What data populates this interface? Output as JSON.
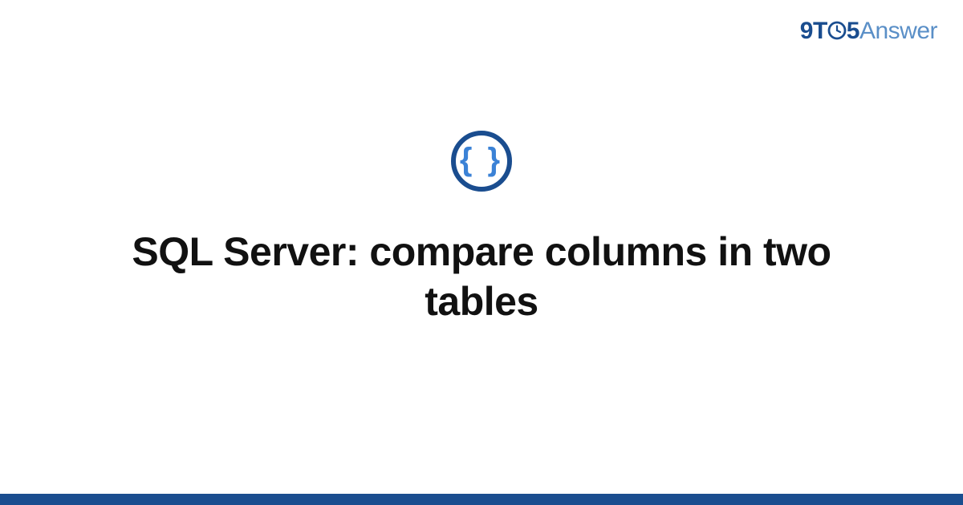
{
  "brand": {
    "part_nine": "9",
    "part_t": "T",
    "part_five": "5",
    "part_answer": "Answer"
  },
  "badge": {
    "glyph": "{ }"
  },
  "title": "SQL Server: compare columns in two tables",
  "colors": {
    "brand_dark": "#1a4d8f",
    "brand_light": "#5a8fc7",
    "accent_blue": "#3b82d6"
  }
}
